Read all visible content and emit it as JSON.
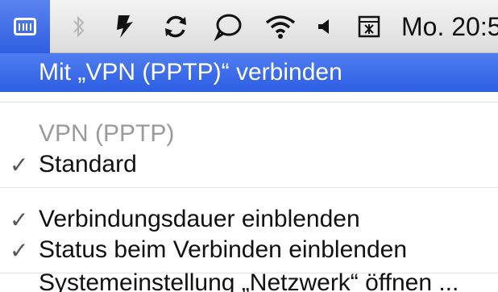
{
  "menubar": {
    "icons": [
      {
        "name": "vpn-icon",
        "active": true
      },
      {
        "name": "bluetooth-icon"
      },
      {
        "name": "sync-icon"
      },
      {
        "name": "time-machine-icon"
      },
      {
        "name": "chat-bubble-icon"
      },
      {
        "name": "wifi-icon"
      },
      {
        "name": "volume-icon"
      },
      {
        "name": "input-menu-icon"
      }
    ],
    "clock": "Mo. 20:5",
    "accent_color": "#2f5fe0"
  },
  "menu": {
    "connect": "Mit „VPN (PPTP)“ verbinden",
    "section_header": "VPN (PPTP)",
    "standard": "Standard",
    "show_duration": "Verbindungsdauer einblenden",
    "show_status": "Status beim Verbinden einblenden",
    "open_prefs": "Systemeinstellung „Netzwerk“ öffnen ...",
    "check_mark": "✓"
  }
}
